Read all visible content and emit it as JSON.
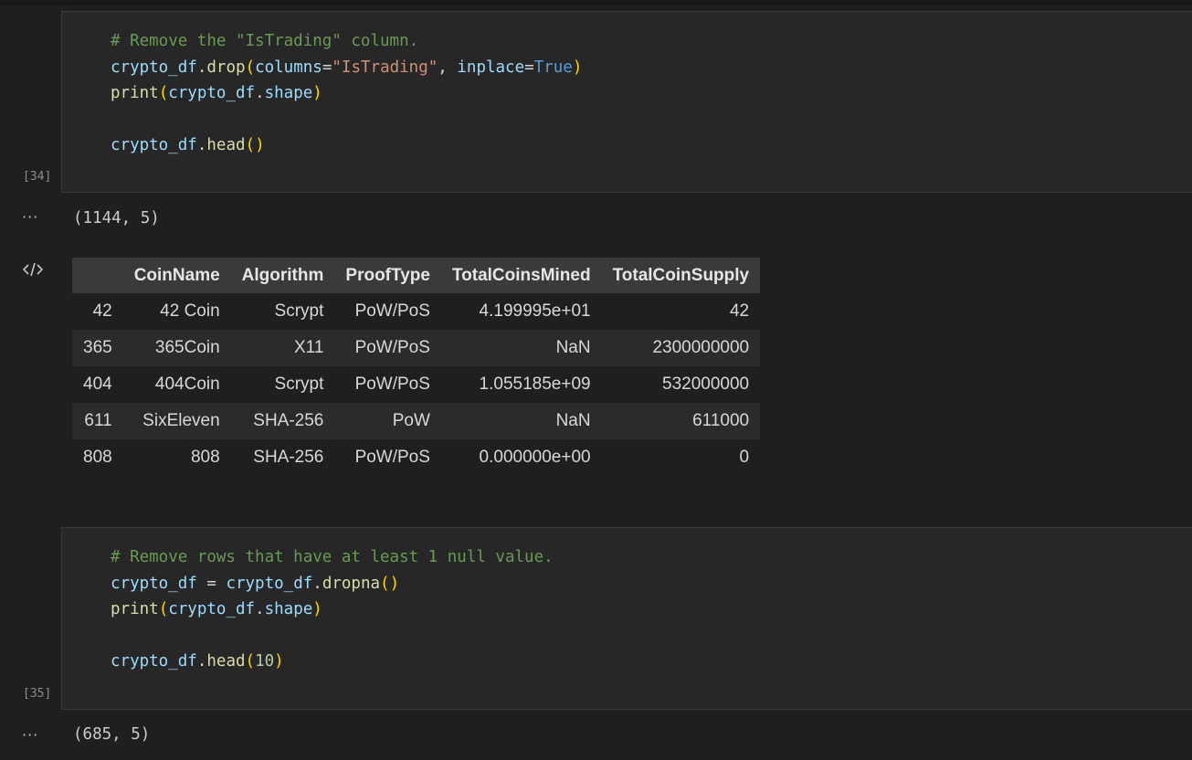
{
  "cells": [
    {
      "exec_count": "[34]",
      "lines": [
        [
          {
            "t": "# Remove the \"IsTrading\" column.",
            "c": "com"
          }
        ],
        [
          {
            "t": "crypto_df",
            "c": "var"
          },
          {
            "t": ".",
            "c": "pun"
          },
          {
            "t": "drop",
            "c": "fn"
          },
          {
            "t": "(",
            "c": "p1"
          },
          {
            "t": "columns",
            "c": "var"
          },
          {
            "t": "=",
            "c": "pun"
          },
          {
            "t": "\"IsTrading\"",
            "c": "str"
          },
          {
            "t": ", ",
            "c": "pun"
          },
          {
            "t": "inplace",
            "c": "var"
          },
          {
            "t": "=",
            "c": "pun"
          },
          {
            "t": "True",
            "c": "kw"
          },
          {
            "t": ")",
            "c": "p1"
          }
        ],
        [
          {
            "t": "print",
            "c": "fn"
          },
          {
            "t": "(",
            "c": "p1"
          },
          {
            "t": "crypto_df",
            "c": "var"
          },
          {
            "t": ".",
            "c": "pun"
          },
          {
            "t": "shape",
            "c": "var"
          },
          {
            "t": ")",
            "c": "p1"
          }
        ],
        [],
        [
          {
            "t": "crypto_df",
            "c": "var"
          },
          {
            "t": ".",
            "c": "pun"
          },
          {
            "t": "head",
            "c": "fn"
          },
          {
            "t": "()",
            "c": "p1"
          }
        ]
      ],
      "output_text": "(1144, 5)"
    },
    {
      "exec_count": "[35]",
      "lines": [
        [
          {
            "t": "# Remove rows that have at least 1 null value.",
            "c": "com"
          }
        ],
        [
          {
            "t": "crypto_df",
            "c": "var"
          },
          {
            "t": " = ",
            "c": "pun"
          },
          {
            "t": "crypto_df",
            "c": "var"
          },
          {
            "t": ".",
            "c": "pun"
          },
          {
            "t": "dropna",
            "c": "fn"
          },
          {
            "t": "()",
            "c": "p1"
          }
        ],
        [
          {
            "t": "print",
            "c": "fn"
          },
          {
            "t": "(",
            "c": "p1"
          },
          {
            "t": "crypto_df",
            "c": "var"
          },
          {
            "t": ".",
            "c": "pun"
          },
          {
            "t": "shape",
            "c": "var"
          },
          {
            "t": ")",
            "c": "p1"
          }
        ],
        [],
        [
          {
            "t": "crypto_df",
            "c": "var"
          },
          {
            "t": ".",
            "c": "pun"
          },
          {
            "t": "head",
            "c": "fn"
          },
          {
            "t": "(",
            "c": "p1"
          },
          {
            "t": "10",
            "c": "num"
          },
          {
            "t": ")",
            "c": "p1"
          }
        ]
      ],
      "output_text": "(685, 5)"
    }
  ],
  "output_menu_glyph": "···",
  "dataframe": {
    "columns": [
      "",
      "CoinName",
      "Algorithm",
      "ProofType",
      "TotalCoinsMined",
      "TotalCoinSupply"
    ],
    "rows": [
      [
        "42",
        "42 Coin",
        "Scrypt",
        "PoW/PoS",
        "4.199995e+01",
        "42"
      ],
      [
        "365",
        "365Coin",
        "X11",
        "PoW/PoS",
        "NaN",
        "2300000000"
      ],
      [
        "404",
        "404Coin",
        "Scrypt",
        "PoW/PoS",
        "1.055185e+09",
        "532000000"
      ],
      [
        "611",
        "SixEleven",
        "SHA-256",
        "PoW",
        "NaN",
        "611000"
      ],
      [
        "808",
        "808",
        "SHA-256",
        "PoW/PoS",
        "0.000000e+00",
        "0"
      ]
    ]
  }
}
